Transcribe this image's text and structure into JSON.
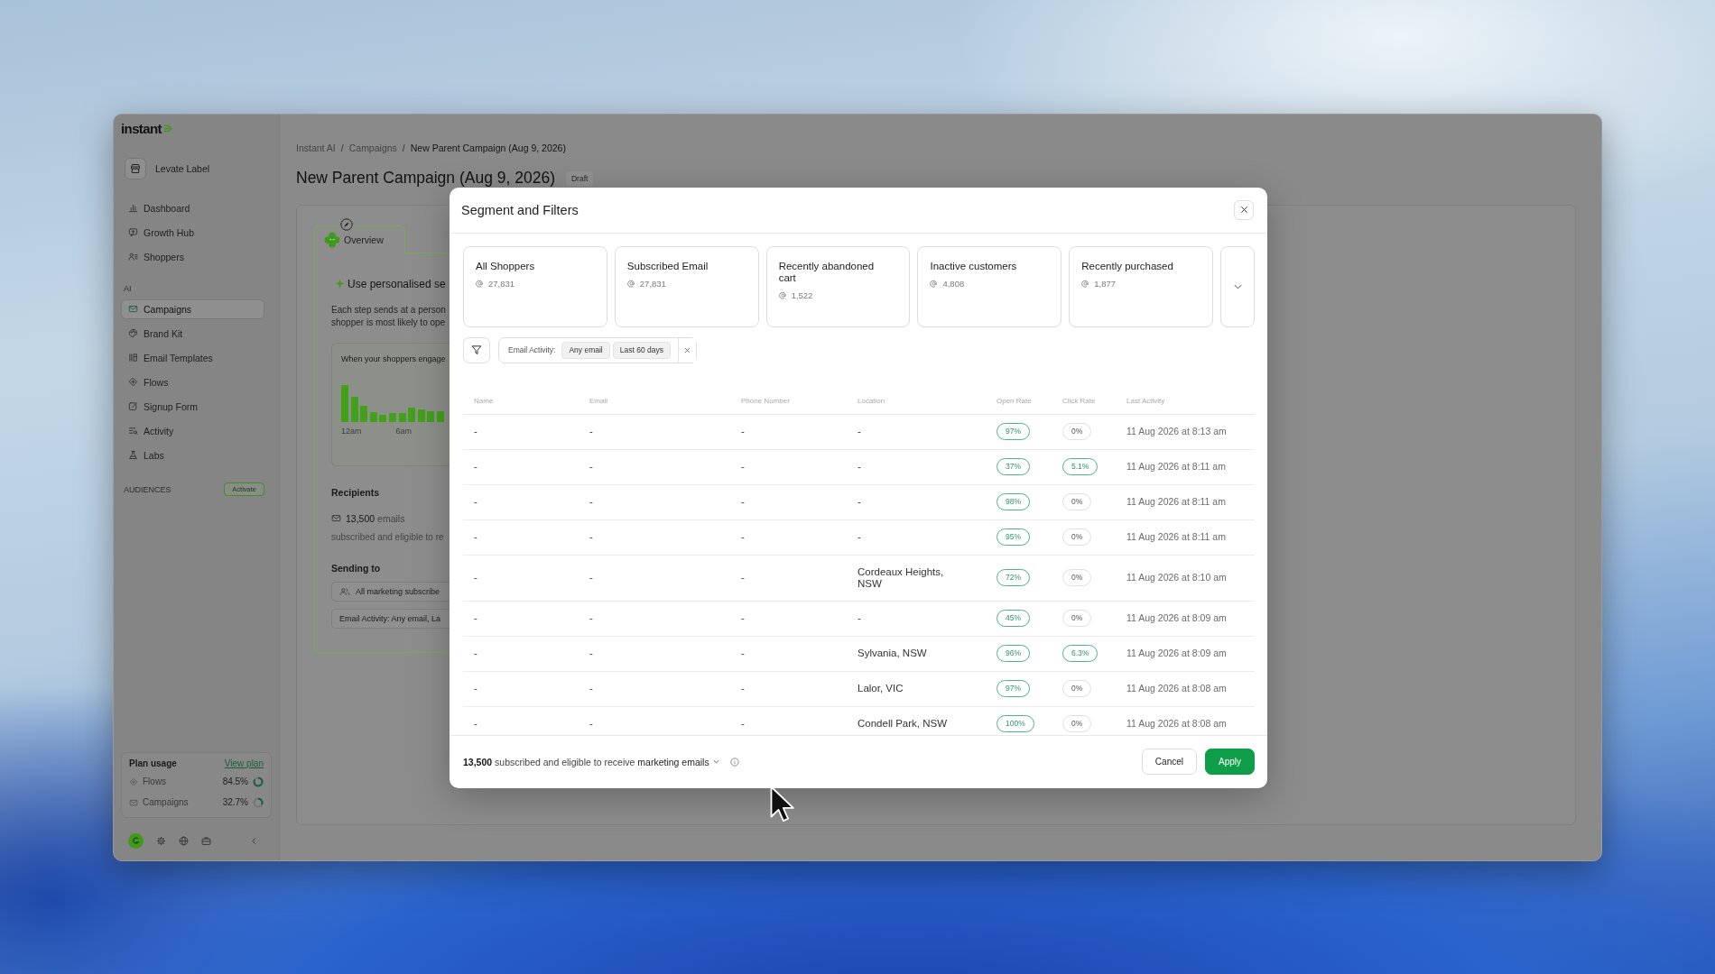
{
  "sidebar": {
    "logo": "instant",
    "workspace": "Levate Label",
    "nav_groups": [
      {
        "items": [
          {
            "label": "Dashboard",
            "selected": false
          },
          {
            "label": "Growth Hub",
            "selected": false
          },
          {
            "label": "Shoppers",
            "selected": false
          }
        ]
      },
      {
        "heading": "AI",
        "items": [
          {
            "label": "Campaigns",
            "selected": true
          },
          {
            "label": "Brand Kit",
            "selected": false
          },
          {
            "label": "Email Templates",
            "selected": false
          },
          {
            "label": "Flows",
            "selected": false
          },
          {
            "label": "Signup Form",
            "selected": false
          },
          {
            "label": "Activity",
            "selected": false
          },
          {
            "label": "Labs",
            "selected": false
          }
        ]
      }
    ],
    "audiences": {
      "heading": "AUDIENCES",
      "action": "Activate"
    },
    "plan_usage": {
      "title": "Plan usage",
      "link": "View plan",
      "rows": [
        {
          "label": "Flows",
          "value": "84.5%"
        },
        {
          "label": "Campaigns",
          "value": "32.7%"
        }
      ]
    }
  },
  "breadcrumbs": {
    "separator": "/",
    "items": [
      "Instant AI",
      "Campaigns",
      "New Parent Campaign (Aug 9, 2026)"
    ]
  },
  "page_title": "New Parent Campaign (Aug 9, 2026)",
  "status_badge": "Draft",
  "overview": {
    "tab": "Overview",
    "heading": "Use personalised se",
    "description_lines": [
      "Each step sends at a person",
      "shopper is most likely to ope"
    ],
    "engagement_chart": {
      "title": "When your shoppers engage",
      "x_labels": [
        "12am",
        "6am"
      ]
    },
    "recipients": {
      "heading": "Recipients",
      "count": "**13,500** emails",
      "note": "subscribed and eligible to re"
    },
    "sending_to": {
      "heading": "Sending to",
      "audience": "All marketing subscribe",
      "filter": "Email Activity: Any email, La"
    }
  },
  "modal": {
    "title": "Segment and Filters",
    "segments": [
      {
        "name": "All Shoppers",
        "count": "27,831"
      },
      {
        "name": "Subscribed Email",
        "count": "27,831"
      },
      {
        "name": "Recently abandoned cart",
        "count": "1,522"
      },
      {
        "name": "Inactive customers",
        "count": "4,808"
      },
      {
        "name": "Recently purchased",
        "count": "1,877"
      }
    ],
    "filter": {
      "label": "Email Activity:",
      "values": [
        "Any email",
        "Last 60 days"
      ]
    },
    "table": {
      "columns": [
        "Name",
        "Email",
        "Phone Number",
        "Location",
        "Open Rate",
        "Click Rate",
        "Last Activity"
      ],
      "rows": [
        {
          "name": "-",
          "email": "-",
          "phone": "-",
          "location": "-",
          "open_rate": {
            "value": "97%",
            "highlighted": true
          },
          "click_rate": {
            "value": "0%",
            "highlighted": false
          },
          "last_activity": "11 Aug 2026 at 8:13 am"
        },
        {
          "name": "-",
          "email": "-",
          "phone": "-",
          "location": "-",
          "open_rate": {
            "value": "37%",
            "highlighted": true
          },
          "click_rate": {
            "value": "5.1%",
            "highlighted": true
          },
          "last_activity": "11 Aug 2026 at 8:11 am"
        },
        {
          "name": "-",
          "email": "-",
          "phone": "-",
          "location": "-",
          "open_rate": {
            "value": "98%",
            "highlighted": true
          },
          "click_rate": {
            "value": "0%",
            "highlighted": false
          },
          "last_activity": "11 Aug 2026 at 8:11 am"
        },
        {
          "name": "-",
          "email": "-",
          "phone": "-",
          "location": "-",
          "open_rate": {
            "value": "95%",
            "highlighted": true
          },
          "click_rate": {
            "value": "0%",
            "highlighted": false
          },
          "last_activity": "11 Aug 2026 at 8:11 am"
        },
        {
          "name": "-",
          "email": "-",
          "phone": "-",
          "location": "Cordeaux Heights, NSW",
          "open_rate": {
            "value": "72%",
            "highlighted": true
          },
          "click_rate": {
            "value": "0%",
            "highlighted": false
          },
          "last_activity": "11 Aug 2026 at 8:10 am"
        },
        {
          "name": "-",
          "email": "-",
          "phone": "-",
          "location": "-",
          "open_rate": {
            "value": "45%",
            "highlighted": true
          },
          "click_rate": {
            "value": "0%",
            "highlighted": false
          },
          "last_activity": "11 Aug 2026 at 8:09 am"
        },
        {
          "name": "-",
          "email": "-",
          "phone": "-",
          "location": "Sylvania, NSW",
          "open_rate": {
            "value": "96%",
            "highlighted": true
          },
          "click_rate": {
            "value": "6.3%",
            "highlighted": true
          },
          "last_activity": "11 Aug 2026 at 8:09 am"
        },
        {
          "name": "-",
          "email": "-",
          "phone": "-",
          "location": "Lalor, VIC",
          "open_rate": {
            "value": "97%",
            "highlighted": true
          },
          "click_rate": {
            "value": "0%",
            "highlighted": false
          },
          "last_activity": "11 Aug 2026 at 8:08 am"
        },
        {
          "name": "-",
          "email": "-",
          "phone": "-",
          "location": "Condell Park, NSW",
          "open_rate": {
            "value": "100%",
            "highlighted": true
          },
          "click_rate": {
            "value": "0%",
            "highlighted": false
          },
          "last_activity": "11 Aug 2026 at 8:08 am"
        }
      ]
    },
    "footer": {
      "summary": "**13,500** subscribed and eligible to receive",
      "audience": "marketing emails",
      "buttons": [
        {
          "label": "Cancel",
          "kind": "secondary"
        },
        {
          "label": "Apply",
          "kind": "primary"
        }
      ]
    }
  }
}
